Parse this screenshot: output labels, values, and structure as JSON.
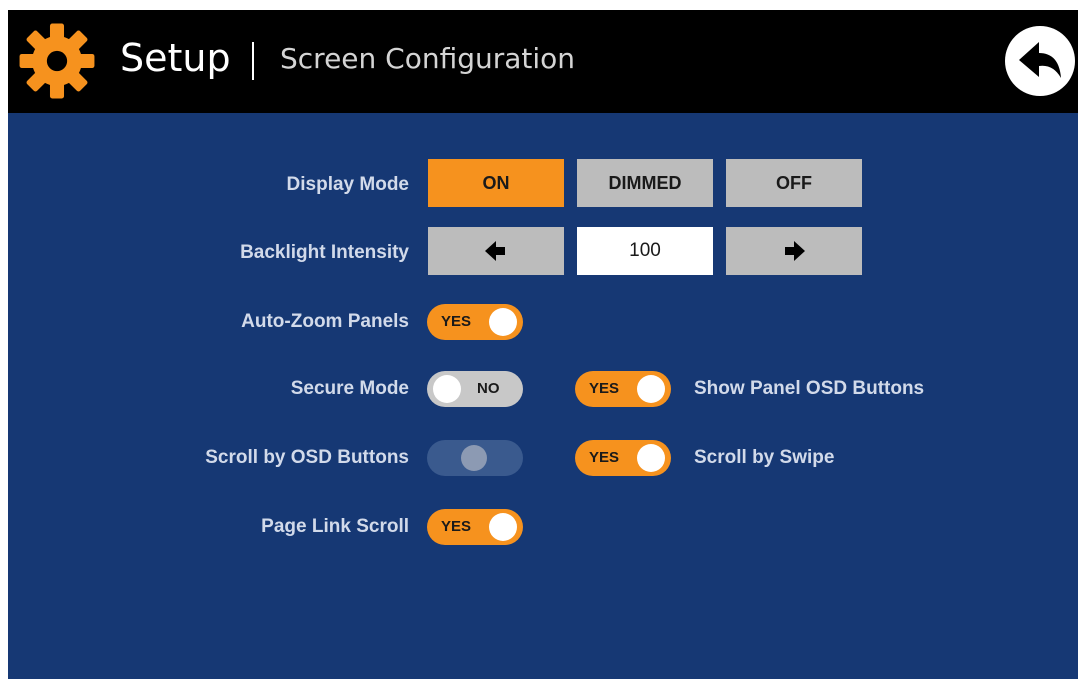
{
  "header": {
    "title": "Setup",
    "subtitle": "Screen Configuration",
    "icon": "gear-icon",
    "back_icon": "back-arrow-icon"
  },
  "display_mode": {
    "label": "Display Mode",
    "options": [
      "ON",
      "DIMMED",
      "OFF"
    ],
    "selected": "ON"
  },
  "backlight": {
    "label": "Backlight Intensity",
    "value": "100",
    "decrease_icon": "arrow-left-icon",
    "increase_icon": "arrow-right-icon"
  },
  "toggles": {
    "auto_zoom": {
      "label": "Auto-Zoom Panels",
      "state": "YES"
    },
    "secure_mode": {
      "label": "Secure Mode",
      "state": "NO"
    },
    "show_panel_osd": {
      "label": "Show Panel OSD Buttons",
      "state": "YES"
    },
    "scroll_osd": {
      "label": "Scroll by OSD Buttons",
      "state": ""
    },
    "scroll_swipe": {
      "label": "Scroll by Swipe",
      "state": "YES"
    },
    "page_link_scroll": {
      "label": "Page Link Scroll",
      "state": "YES"
    }
  },
  "colors": {
    "background": "#163874",
    "header": "#000000",
    "accent": "#f6921e",
    "button_gray": "#bcbcbc"
  }
}
